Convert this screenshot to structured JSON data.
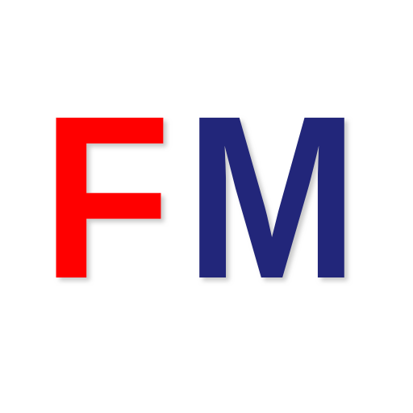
{
  "logo": {
    "letter_left": "F",
    "letter_right": "M",
    "color_left": "#ff0000",
    "color_right": "#22287a",
    "shadow_color": "#9a9a9a"
  }
}
